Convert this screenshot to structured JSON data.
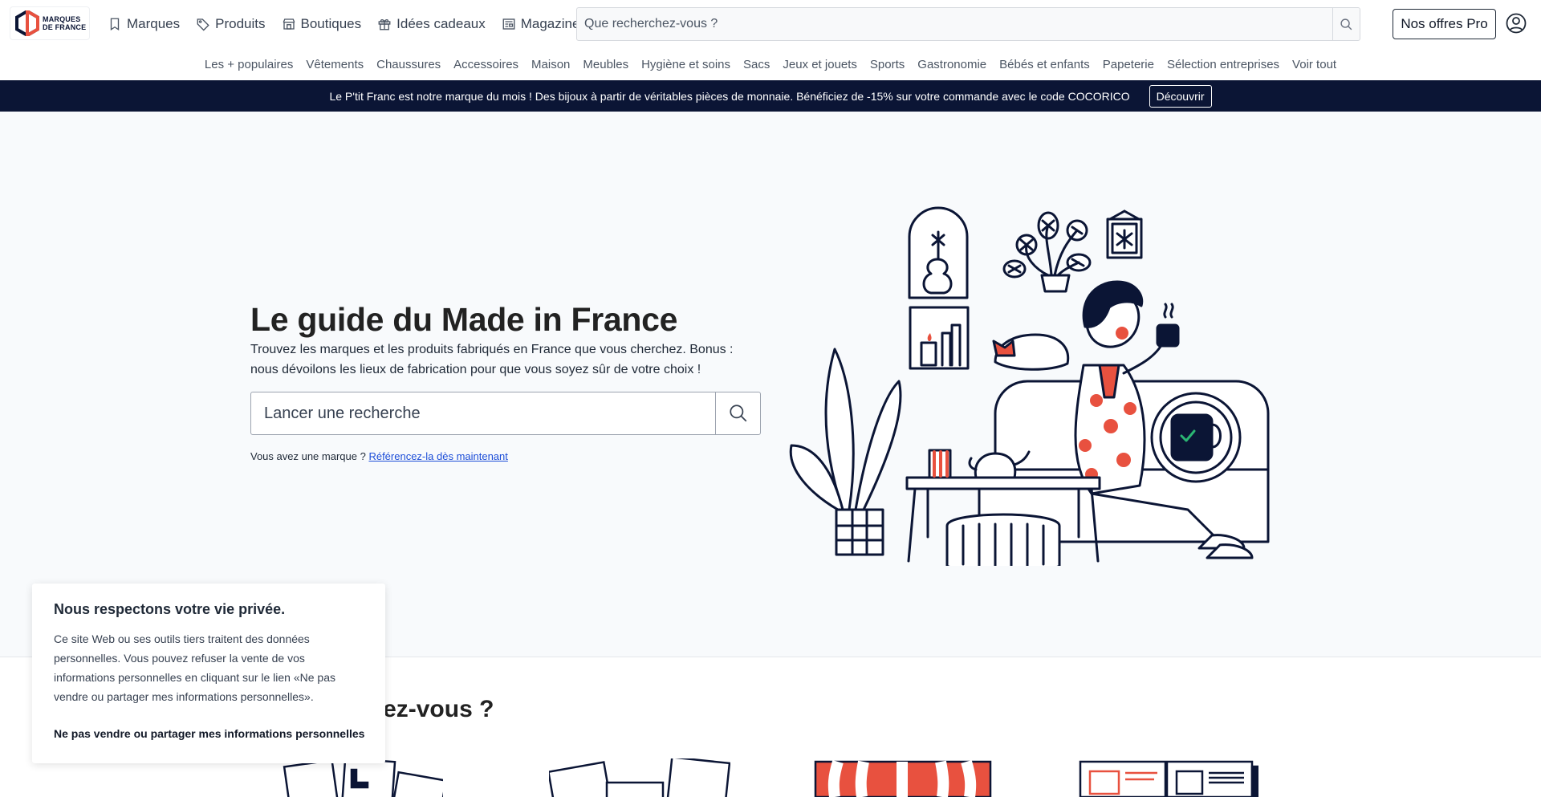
{
  "brand": {
    "logo_line1": "MARQUES",
    "logo_line2": "DE FRANCE",
    "colors": {
      "navy": "#0b1535",
      "red": "#e8513f"
    }
  },
  "mainnav": [
    {
      "label": "Marques",
      "icon": "bookmark-icon"
    },
    {
      "label": "Produits",
      "icon": "tag-icon"
    },
    {
      "label": "Boutiques",
      "icon": "store-icon"
    },
    {
      "label": "Idées cadeaux",
      "icon": "gift-icon"
    },
    {
      "label": "Magazine",
      "icon": "newspaper-icon"
    }
  ],
  "search": {
    "placeholder": "Que recherchez-vous ?"
  },
  "header": {
    "pro_label": "Nos offres Pro",
    "user_icon": "user-circle-icon"
  },
  "categories": [
    "Les + populaires",
    "Vêtements",
    "Chaussures",
    "Accessoires",
    "Maison",
    "Meubles",
    "Hygiène et soins",
    "Sacs",
    "Jeux et jouets",
    "Sports",
    "Gastronomie",
    "Bébés et enfants",
    "Papeterie",
    "Sélection entreprises",
    "Voir tout"
  ],
  "promo": {
    "text": "Le P'tit Franc est notre marque du mois ! Des bijoux à partir de véritables pièces de monnaie. Bénéficiez de -15% sur votre commande avec le code COCORICO",
    "button": "Découvrir"
  },
  "hero": {
    "title": "Le guide du Made in France",
    "subtitle": "Trouvez les marques et les produits fabriqués en France que vous cherchez. Bonus : nous dévoilons les lieux de fabrication pour que vous soyez sûr de votre choix !",
    "search_placeholder": "Lancer une recherche",
    "brand_prompt": "Vous avez une marque ?",
    "brand_link": "Référencez-la dès maintenant"
  },
  "section2": {
    "title_visible": "chez-vous ?"
  },
  "cookie": {
    "title": "Nous respectons votre vie privée.",
    "body": "Ce site Web ou ses outils tiers traitent des données personnelles. Vous pouvez refuser la vente de vos informations personnelles en cliquant sur le lien «Ne pas vendre ou partager mes informations personnelles».",
    "optout": "Ne pas vendre ou partager mes informations personnelles"
  }
}
